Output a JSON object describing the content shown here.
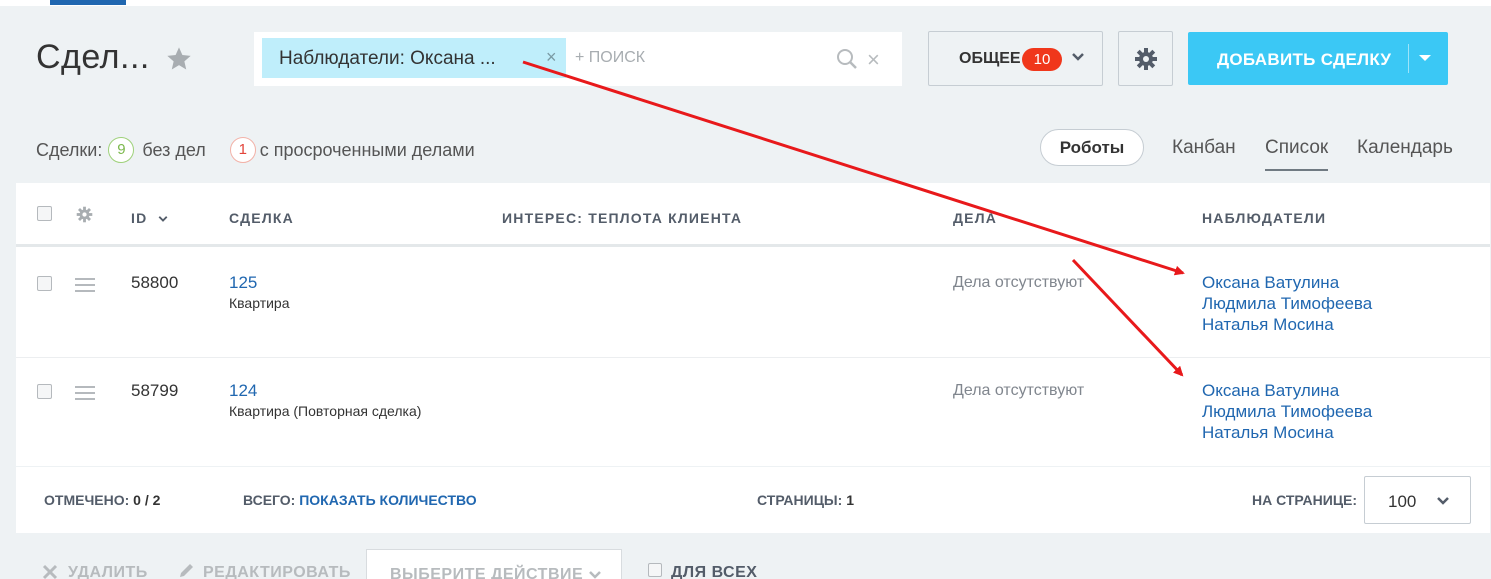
{
  "header": {
    "title": "Сдел...",
    "search": {
      "filter_chip": "Наблюдатели: Оксана ...",
      "chip_close": "×",
      "placeholder": "+ поиск",
      "clear": "×"
    },
    "general_button": {
      "label": "ОБЩЕЕ",
      "badge": "10"
    },
    "add_button": {
      "label": "ДОБАВИТЬ СДЕЛКУ"
    }
  },
  "counters": {
    "deals_label": "Сделки:",
    "no_tasks_count": "9",
    "no_tasks_label": "без дел",
    "overdue_count": "1",
    "overdue_label": "с просроченными делами"
  },
  "views": {
    "robots": "Роботы",
    "tabs": [
      "Канбан",
      "Список",
      "Календарь"
    ],
    "active": "Список"
  },
  "grid": {
    "columns": {
      "id": "ID",
      "deal": "СДЕЛКА",
      "interest": "ИНТЕРЕС: ТЕПЛОТА КЛИЕНТА",
      "tasks": "ДЕЛА",
      "observers": "НАБЛЮДАТЕЛИ"
    },
    "rows": [
      {
        "id": "58800",
        "deal": "125",
        "type": "Квартира",
        "tasks": "Дела отсутствуют",
        "observers": [
          "Оксана Ватулина",
          "Людмила Тимофеева",
          "Наталья Мосина"
        ]
      },
      {
        "id": "58799",
        "deal": "124",
        "type": "Квартира (Повторная сделка)",
        "tasks": "Дела отсутствуют",
        "observers": [
          "Оксана Ватулина",
          "Людмила Тимофеева",
          "Наталья Мосина"
        ]
      }
    ]
  },
  "footer": {
    "marked_label": "ОТМЕЧЕНО:",
    "marked_value": "0 / 2",
    "total_label": "ВСЕГО:",
    "total_link": "ПОКАЗАТЬ КОЛИЧЕСТВО",
    "pages_label": "СТРАНИЦЫ:",
    "pages_value": "1",
    "per_page_label": "НА СТРАНИЦЕ:",
    "per_page_value": "100"
  },
  "actions": {
    "delete": "УДАЛИТЬ",
    "edit": "РЕДАКТИРОВАТЬ",
    "select_action": "ВЫБЕРИТЕ ДЕЙСТВИЕ",
    "for_all": "ДЛЯ ВСЕХ"
  },
  "colors": {
    "accent_blue": "#3bc8f5",
    "link_blue": "#2067b0",
    "badge_red": "#f0371b",
    "annotation_arrow": "#e8191b"
  }
}
